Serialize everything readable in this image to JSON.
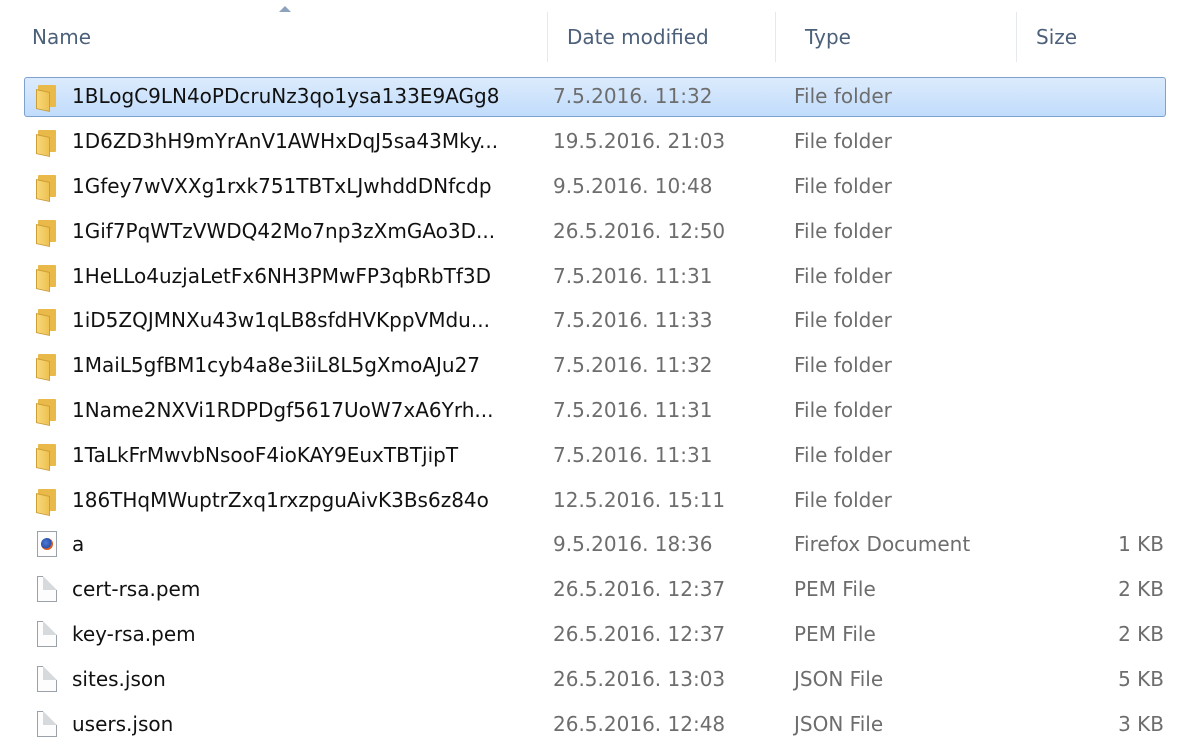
{
  "columns": {
    "name": "Name",
    "date": "Date modified",
    "type": "Type",
    "size": "Size"
  },
  "files": [
    {
      "icon": "folder-icon",
      "name": "1BLogC9LN4oPDcruNz3qo1ysa133E9AGg8",
      "date": "7.5.2016. 11:32",
      "type": "File folder",
      "size": "",
      "selected": true
    },
    {
      "icon": "folder-icon",
      "name": "1D6ZD3hH9mYrAnV1AWHxDqJ5sa43Mky...",
      "date": "19.5.2016. 21:03",
      "type": "File folder",
      "size": ""
    },
    {
      "icon": "folder-icon",
      "name": "1Gfey7wVXXg1rxk751TBTxLJwhddDNfcdp",
      "date": "9.5.2016. 10:48",
      "type": "File folder",
      "size": ""
    },
    {
      "icon": "folder-icon",
      "name": "1Gif7PqWTzVWDQ42Mo7np3zXmGAo3D...",
      "date": "26.5.2016. 12:50",
      "type": "File folder",
      "size": ""
    },
    {
      "icon": "folder-icon",
      "name": "1HeLLo4uzjaLetFx6NH3PMwFP3qbRbTf3D",
      "date": "7.5.2016. 11:31",
      "type": "File folder",
      "size": ""
    },
    {
      "icon": "folder-icon",
      "name": "1iD5ZQJMNXu43w1qLB8sfdHVKppVMdu...",
      "date": "7.5.2016. 11:33",
      "type": "File folder",
      "size": ""
    },
    {
      "icon": "folder-icon",
      "name": "1MaiL5gfBM1cyb4a8e3iiL8L5gXmoAJu27",
      "date": "7.5.2016. 11:32",
      "type": "File folder",
      "size": ""
    },
    {
      "icon": "folder-icon",
      "name": "1Name2NXVi1RDPDgf5617UoW7xA6Yrh...",
      "date": "7.5.2016. 11:31",
      "type": "File folder",
      "size": ""
    },
    {
      "icon": "folder-icon",
      "name": "1TaLkFrMwvbNsooF4ioKAY9EuxTBTjipT",
      "date": "7.5.2016. 11:31",
      "type": "File folder",
      "size": ""
    },
    {
      "icon": "folder-icon",
      "name": "186THqMWuptrZxq1rxzpguAivK3Bs6z84o",
      "date": "12.5.2016. 15:11",
      "type": "File folder",
      "size": ""
    },
    {
      "icon": "firefox-document-icon",
      "name": "a",
      "date": "9.5.2016. 18:36",
      "type": "Firefox Document",
      "size": "1 KB"
    },
    {
      "icon": "file-icon",
      "name": "cert-rsa.pem",
      "date": "26.5.2016. 12:37",
      "type": "PEM File",
      "size": "2 KB"
    },
    {
      "icon": "file-icon",
      "name": "key-rsa.pem",
      "date": "26.5.2016. 12:37",
      "type": "PEM File",
      "size": "2 KB"
    },
    {
      "icon": "file-icon",
      "name": "sites.json",
      "date": "26.5.2016. 13:03",
      "type": "JSON File",
      "size": "5 KB"
    },
    {
      "icon": "file-icon",
      "name": "users.json",
      "date": "26.5.2016. 12:48",
      "type": "JSON File",
      "size": "3 KB"
    }
  ],
  "colors": {
    "header_text": "#4c607a",
    "selection_border": "#7da2ce",
    "selection_fill": "#cce4fc",
    "muted_text": "#6d6d6d"
  }
}
